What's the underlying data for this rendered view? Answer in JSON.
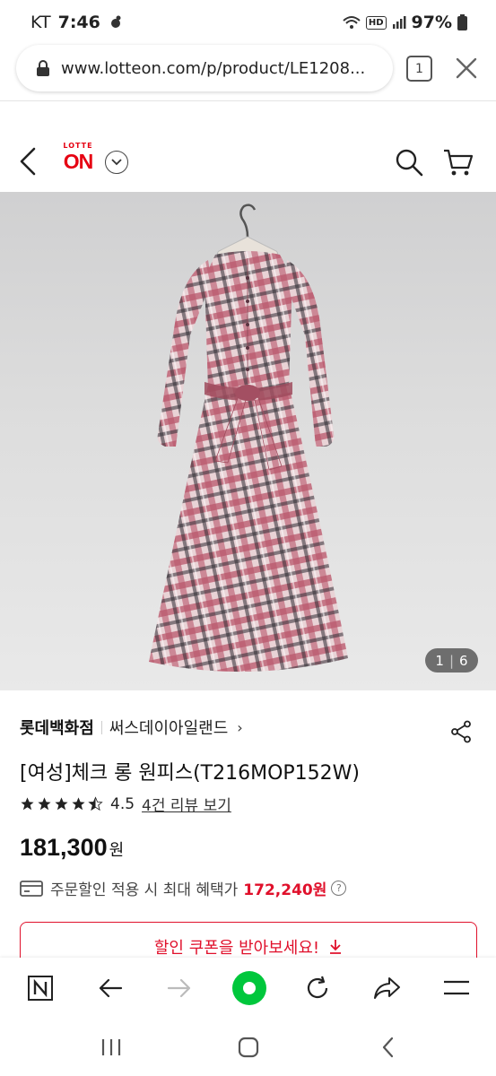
{
  "status_bar": {
    "carrier": "KT",
    "time": "7:46",
    "hd": "HD",
    "battery": "97%"
  },
  "browser": {
    "url": "www.lotteon.com/p/product/LE1208...",
    "tab_count": "1"
  },
  "site": {
    "logo_top": "LOTTE",
    "logo_main": "ON"
  },
  "product": {
    "image_counter": {
      "current": "1",
      "separator": "|",
      "total": "6"
    },
    "brand": "롯데백화점",
    "store": "써스데이아일랜드",
    "store_chevron": "›",
    "title": "[여성]체크 롱 원피스(T216MOP152W)",
    "rating_score": "4.5",
    "rating_stars_value": 4.5,
    "reviews_link": "4건 리뷰 보기",
    "price": "181,300",
    "currency": "원",
    "benefit_text": "주문할인 적용 시 최대 혜택가",
    "benefit_price": "172,240원",
    "help": "?",
    "coupon_button": "할인 쿠폰을 받아보세요!"
  },
  "colors": {
    "brand_red": "#e60012",
    "price_red": "#e0102b",
    "active_green": "#00c73c"
  },
  "icons": {
    "browser_toolbar": [
      "naver-n-icon",
      "back-arrow-icon",
      "forward-arrow-icon",
      "home-green-dot-icon",
      "reload-icon",
      "share-arrow-icon",
      "menu-icon"
    ],
    "nav": [
      "recent-apps-icon",
      "home-icon",
      "back-icon"
    ]
  }
}
